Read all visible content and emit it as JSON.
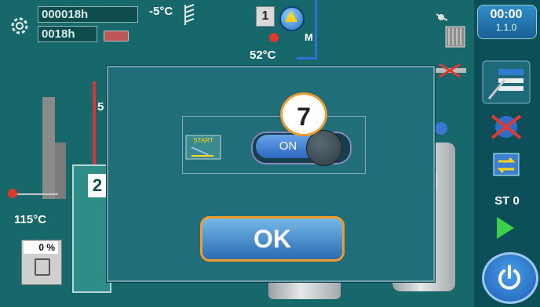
{
  "status": {
    "total_hours": "000018h",
    "session_hours": "0018h",
    "outdoor_temp": "-5°C"
  },
  "circuit": {
    "number": "1",
    "valve_label": "M",
    "flow_temp": "52°C"
  },
  "boiler": {
    "number": "2",
    "temperature": "115°C",
    "fuel_level": "0 %",
    "partial_label": "5"
  },
  "sidebar": {
    "time": "00:00",
    "date": "1.1.0",
    "state": "ST 0"
  },
  "modal": {
    "step_badge": "7",
    "toggle_label": "ON",
    "toggle_state": "on",
    "start_icon_text": "START",
    "ok_label": "OK"
  },
  "colors": {
    "background": "#17686a",
    "accent_orange": "#f29a2b",
    "button_blue": "#2a6db3"
  }
}
